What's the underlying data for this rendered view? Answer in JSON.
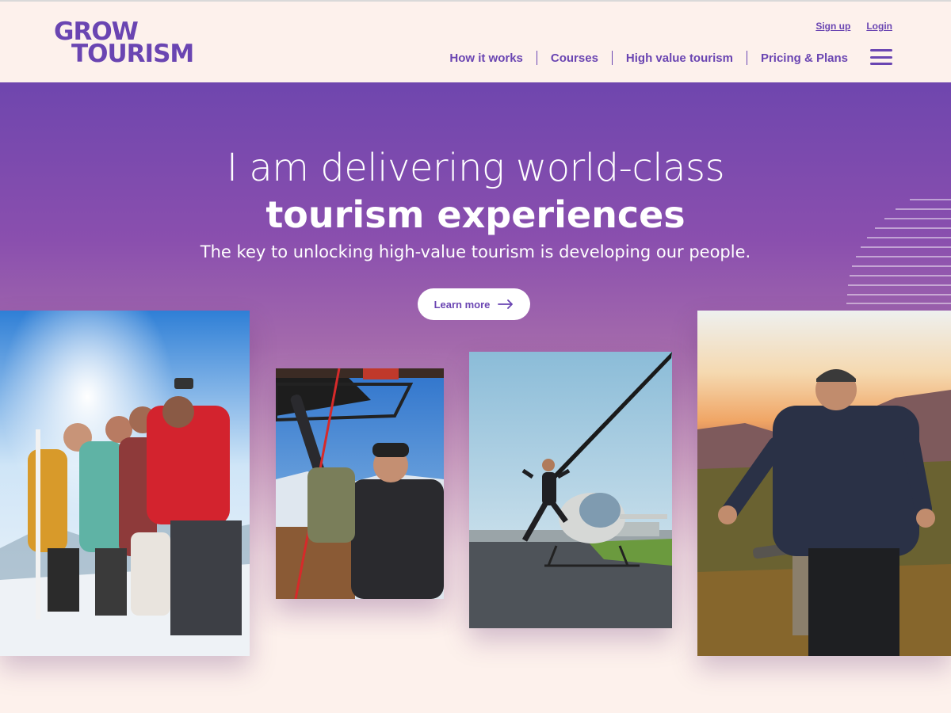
{
  "brand": {
    "logo_line1": "GROW",
    "logo_line2": "TOURISM",
    "color": "#6a45b2"
  },
  "header": {
    "top_links": [
      {
        "label": "Sign up"
      },
      {
        "label": "Login"
      }
    ],
    "nav": [
      {
        "label": "How it works"
      },
      {
        "label": "Courses"
      },
      {
        "label": "High value tourism"
      },
      {
        "label": "Pricing & Plans"
      }
    ],
    "menu_icon": "hamburger-menu-icon"
  },
  "hero": {
    "title_line1": "I am delivering world-class",
    "title_line2": "tourism experiences",
    "subtitle": "The key to unlocking high-value tourism is developing our people.",
    "cta_label": "Learn more",
    "cta_icon": "arrow-right-icon",
    "gradient_top": "#6f46ae",
    "gradient_bottom": "#fdf1ec"
  },
  "photos": [
    {
      "subject": "ski-group-selfie-photo"
    },
    {
      "subject": "hot-air-balloon-selfie-photo"
    },
    {
      "subject": "helicopter-jump-photo"
    },
    {
      "subject": "guide-sunset-photo"
    }
  ]
}
